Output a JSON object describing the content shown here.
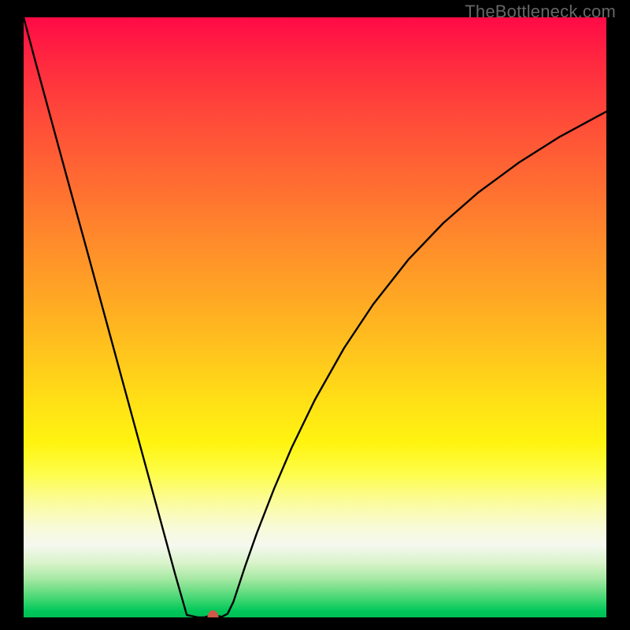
{
  "watermark": "TheBottleneck.com",
  "chart_data": {
    "type": "line",
    "title": "",
    "xlabel": "",
    "ylabel": "",
    "xlim": [
      0,
      100
    ],
    "ylim": [
      0,
      100
    ],
    "grid": false,
    "legend": false,
    "x": [
      0,
      2,
      5,
      8,
      11,
      14,
      17,
      20,
      23,
      26,
      28,
      30,
      31,
      32,
      33,
      34,
      35,
      36,
      38,
      40,
      43,
      46,
      50,
      55,
      60,
      66,
      72,
      78,
      85,
      92,
      100
    ],
    "values": [
      100.0,
      92.7,
      82.0,
      71.3,
      60.7,
      50.0,
      39.3,
      28.6,
      17.9,
      7.2,
      0.4,
      0.0,
      0.0,
      0.3,
      0.3,
      0.1,
      0.6,
      2.6,
      8.5,
      14.0,
      21.5,
      28.3,
      36.3,
      44.9,
      52.2,
      59.6,
      65.7,
      70.8,
      75.8,
      80.1,
      84.3
    ],
    "gradient_colors": {
      "top": "#ff0a46",
      "upper_mid": "#ff8a2b",
      "mid": "#ffe016",
      "lower_mid": "#fbfca0",
      "bottom": "#00bf55"
    },
    "marker": {
      "x": 32.5,
      "y": 0,
      "color": "#d05a4a",
      "rx": 7,
      "ry": 9
    }
  }
}
